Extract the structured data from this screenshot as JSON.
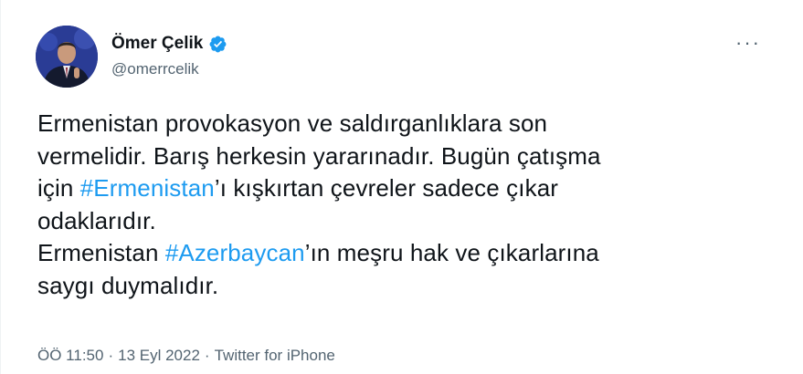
{
  "author": {
    "display_name": "Ömer Çelik",
    "handle": "@omerrcelik",
    "verified": true
  },
  "more_menu": "···",
  "tweet": {
    "lines": [
      [
        {
          "text": "Ermenistan provokasyon ve saldırganlıklara son"
        }
      ],
      [
        {
          "text": "vermelidir. Barış herkesin yararınadır. Bugün çatışma"
        }
      ],
      [
        {
          "text": "için "
        },
        {
          "text": "#Ermenistan",
          "hashtag": true
        },
        {
          "text": "’ı kışkırtan çevreler sadece çıkar"
        }
      ],
      [
        {
          "text": "odaklarıdır."
        }
      ],
      [
        {
          "text": "Ermenistan "
        },
        {
          "text": "#Azerbaycan",
          "hashtag": true
        },
        {
          "text": "’ın meşru hak ve çıkarlarına"
        }
      ],
      [
        {
          "text": "saygı duymalıdır."
        }
      ]
    ]
  },
  "meta": {
    "time": "ÖÖ 11:50",
    "separator": "·",
    "date": "13 Eyl 2022",
    "source": "Twitter for iPhone"
  },
  "colors": {
    "hashtag": "#1d9bf0",
    "secondary_text": "#536471",
    "verified_badge": "#1d9bf0"
  }
}
